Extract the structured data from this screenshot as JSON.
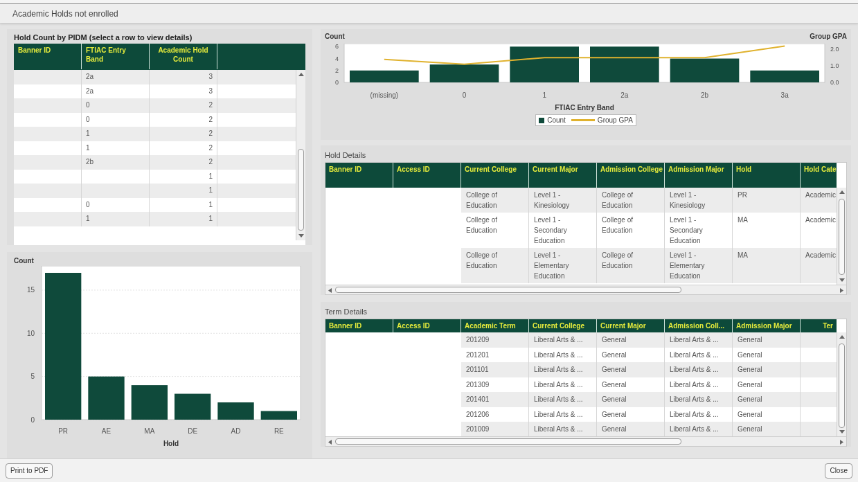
{
  "window": {
    "title": "Academic Holds not enrolled"
  },
  "hold_count_panel": {
    "title": "Hold Count by PIDM (select a row to view details)",
    "columns": [
      "Banner ID",
      "FTIAC Entry Band",
      "Academic Hold Count"
    ],
    "rows": [
      {
        "band": "2a",
        "count": "3"
      },
      {
        "band": "2a",
        "count": "3"
      },
      {
        "band": "0",
        "count": "2"
      },
      {
        "band": "0",
        "count": "2"
      },
      {
        "band": "1",
        "count": "2"
      },
      {
        "band": "1",
        "count": "2"
      },
      {
        "band": "2b",
        "count": "2"
      },
      {
        "count": "1"
      },
      {
        "count": "1"
      },
      {
        "band": "0",
        "count": "1"
      },
      {
        "band": "1",
        "count": "1"
      }
    ]
  },
  "band_chart": {
    "chart_data": {
      "type": "bar",
      "ylabel": "Count",
      "xlabel": "FTIAC Entry Band",
      "categories": [
        "(missing)",
        "0",
        "1",
        "2a",
        "2b",
        "3a"
      ],
      "yticks": [
        0,
        2,
        4,
        6
      ],
      "ylim": [
        0,
        6.5
      ],
      "series": [
        {
          "name": "Count",
          "color": "#0f4a3b",
          "values": [
            2,
            3,
            6,
            6,
            4,
            2
          ]
        }
      ]
    }
  },
  "gpa_chart": {
    "chart_data": {
      "type": "line",
      "ylabel": "Group GPA",
      "categories": [
        null,
        null,
        null,
        null,
        null,
        null
      ],
      "yticks": [
        {
          "value": 0,
          "label": "0.0"
        },
        {
          "value": 1,
          "label": "1.0"
        },
        {
          "value": 2,
          "label": "2.0"
        }
      ],
      "ylim": [
        0,
        2.35
      ],
      "series": [
        {
          "name": "Group GPA",
          "color": "#e0b22e",
          "values": [
            1.4,
            1.1,
            1.5,
            1.5,
            1.5,
            2.2
          ]
        }
      ]
    }
  },
  "hold_details": {
    "title": "Hold Details",
    "columns": [
      "Banner ID",
      "Access ID",
      "Current College",
      "Current Major",
      "Admission College",
      "Admission Major",
      "Hold",
      "Hold Cate"
    ],
    "rows": [
      {
        "current_college": "College of Education",
        "current_major": "Level 1 - Kinesiology",
        "admission_college": "College of Education",
        "admission_major": "Level 1 - Kinesiology",
        "hold": "PR",
        "hold_category": "Academic"
      },
      {
        "current_college": "College of Education",
        "current_major": "Level 1 - Secondary Education",
        "admission_college": "College of Education",
        "admission_major": "Level 1 - Secondary Education",
        "hold": "MA",
        "hold_category": "Academic"
      },
      {
        "current_college": "College of Education",
        "current_major": "Level 1 - Elementary Education",
        "admission_college": "College of Education",
        "admission_major": "Level 1 - Elementary Education",
        "hold": "MA",
        "hold_category": "Academic"
      }
    ]
  },
  "hold_chart": {
    "chart_data": {
      "type": "bar",
      "ylabel": "Count",
      "xlabel": "Hold",
      "categories": [
        "PR",
        "AE",
        "MA",
        "DE",
        "AD",
        "RE"
      ],
      "yticks": [
        0,
        5,
        10,
        15
      ],
      "ylim": [
        0,
        17.8
      ],
      "grid": true,
      "series": [
        {
          "color": "#0f4a3b",
          "values": [
            17,
            5,
            4,
            3,
            2,
            1
          ]
        }
      ]
    }
  },
  "term_details": {
    "title": "Term Details",
    "columns": [
      "Banner ID",
      "Access ID",
      "Academic Term",
      "Current College",
      "Current Major",
      "Admission Coll...",
      "Admission Major",
      "Ter"
    ],
    "rows": [
      {
        "term": "201209",
        "current_college": "Liberal Arts & ...",
        "current_major": "General",
        "admission_college": "Liberal Arts & ...",
        "admission_major": "General"
      },
      {
        "term": "201201",
        "current_college": "Liberal Arts & ...",
        "current_major": "General",
        "admission_college": "Liberal Arts & ...",
        "admission_major": "General"
      },
      {
        "term": "201101",
        "current_college": "Liberal Arts & ...",
        "current_major": "General",
        "admission_college": "Liberal Arts & ...",
        "admission_major": "General"
      },
      {
        "term": "201309",
        "current_college": "Liberal Arts & ...",
        "current_major": "General",
        "admission_college": "Liberal Arts & ...",
        "admission_major": "General"
      },
      {
        "term": "201401",
        "current_college": "Liberal Arts & ...",
        "current_major": "General",
        "admission_college": "Liberal Arts & ...",
        "admission_major": "General"
      },
      {
        "term": "201206",
        "current_college": "Liberal Arts & ...",
        "current_major": "General",
        "admission_college": "Liberal Arts & ...",
        "admission_major": "General"
      },
      {
        "term": "201009",
        "current_college": "Liberal Arts & ...",
        "current_major": "General",
        "admission_college": "Liberal Arts & ...",
        "admission_major": "General"
      }
    ]
  },
  "footer": {
    "buttons": [
      "Print to PDF",
      "Close"
    ]
  }
}
